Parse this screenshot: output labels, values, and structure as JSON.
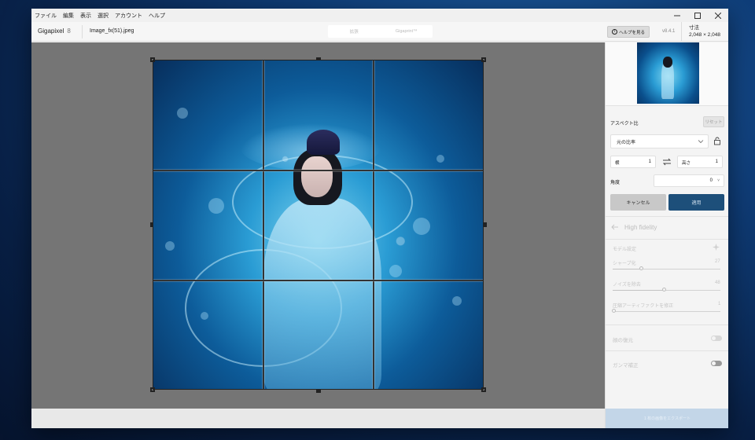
{
  "menubar": {
    "items": [
      "ファイル",
      "編集",
      "表示",
      "選択",
      "アカウント",
      "ヘルプ"
    ]
  },
  "toolbar": {
    "app_name": "Gigapixel",
    "app_major": "8",
    "filename": "Image_fx(51).jpeg",
    "mode_tabs": [
      "拡張",
      "Gigaprint™"
    ],
    "help_label": "ヘルプを見る",
    "version": "v8.4.1",
    "dims_label": "寸法",
    "dims_value": "2,048 × 2,048"
  },
  "crop_panel": {
    "aspect_label": "アスペクト比",
    "reset_label": "リセット",
    "ratio_select": "元の比率",
    "width_label": "横",
    "width_value": "1",
    "height_label": "高さ",
    "height_value": "1",
    "angle_label": "角度",
    "angle_value": "0",
    "angle_caret": "˅",
    "cancel_label": "キャンセル",
    "apply_label": "適用"
  },
  "model_panel": {
    "model_name": "High fidelity",
    "model_settings_label": "モデル設定",
    "sharpen_label": "シャープ化",
    "sharpen_value": "27",
    "sharpen_level": 0.27,
    "denoise_label": "ノイズを除去",
    "denoise_value": "48",
    "denoise_level": 0.48,
    "artifact_label": "圧縮アーティファクトを修正",
    "artifact_value": "1",
    "artifact_level": 0.01,
    "face_recovery_label": "顔の復元",
    "gamma_label": "ガンマ補正",
    "export_label": "1 枚の画像をエクスポート"
  }
}
